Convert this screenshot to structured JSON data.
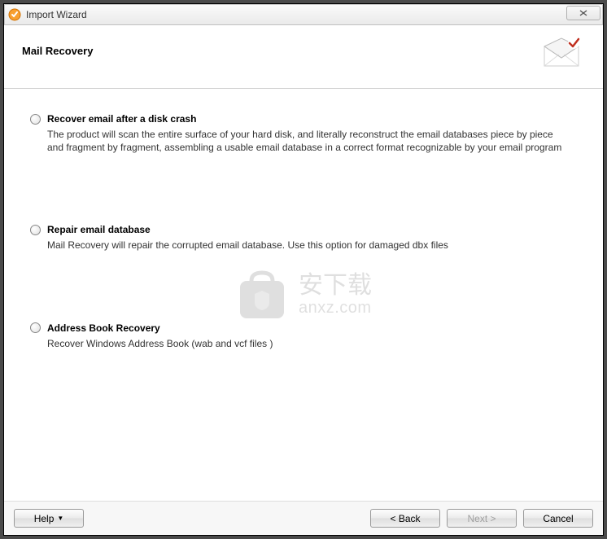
{
  "window": {
    "title": "Import Wizard"
  },
  "header": {
    "title": "Mail Recovery"
  },
  "options": [
    {
      "label": "Recover email after a disk crash",
      "description": "The product will scan the entire surface of your hard disk, and literally reconstruct the email databases piece by piece and fragment by fragment, assembling a usable email database in a correct format recognizable by your email program"
    },
    {
      "label": "Repair email database",
      "description": "Mail Recovery will repair the corrupted email database. Use this option for damaged dbx files"
    },
    {
      "label": "Address Book Recovery",
      "description": "Recover Windows Address Book (wab and vcf files )"
    }
  ],
  "buttons": {
    "help": "Help",
    "back": "< Back",
    "next": "Next >",
    "cancel": "Cancel"
  },
  "watermark": {
    "cn": "安下载",
    "url": "anxz.com"
  }
}
